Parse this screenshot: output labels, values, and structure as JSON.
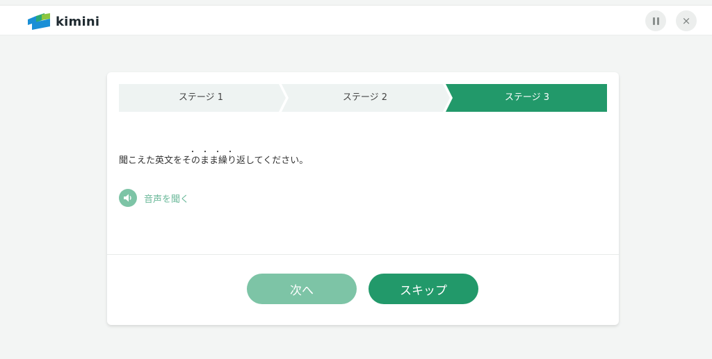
{
  "app": {
    "brand": "kimini",
    "pause_icon": "pause-icon",
    "close_label": "×"
  },
  "stages": [
    {
      "label": "ステージ 1",
      "active": false
    },
    {
      "label": "ステージ 2",
      "active": false
    },
    {
      "label": "ステージ 3",
      "active": true
    }
  ],
  "question": {
    "instruction": "聞こえた英文をそのまま繰り返してください。",
    "emphasis_dots": "・・・・",
    "audio_label": "音声を聞く",
    "audio_icon": "speaker-icon"
  },
  "actions": {
    "next_label": "次へ",
    "skip_label": "スキップ"
  },
  "colors": {
    "accent": "#22996a",
    "accent_light": "#7dc4a6",
    "stage_inactive": "#eef3f2"
  }
}
